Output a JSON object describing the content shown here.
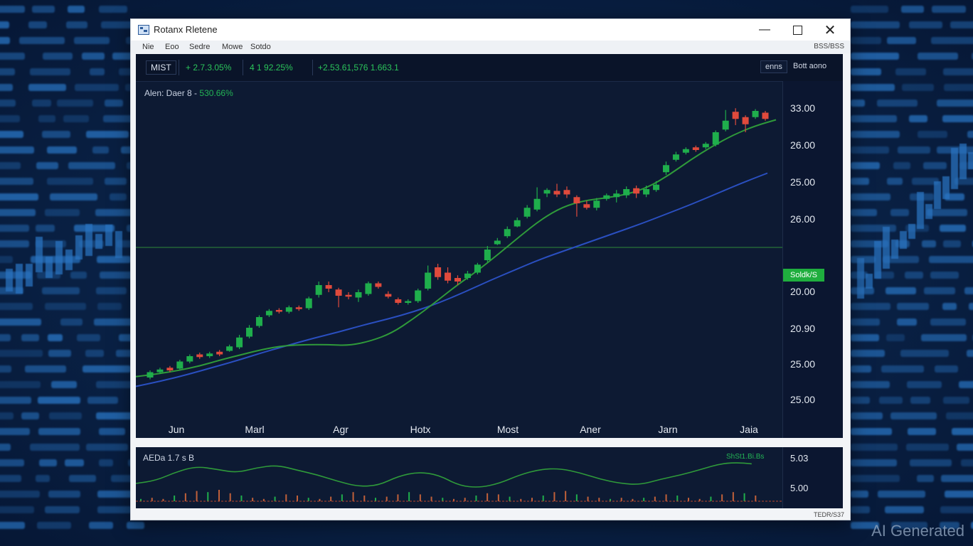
{
  "window": {
    "title": "Rotanx Rletene"
  },
  "menu": {
    "items": [
      "Nie",
      "Eoo",
      "Sedre",
      "Mowe",
      "Sotdo"
    ],
    "right_text": "BSS/BSS"
  },
  "ticker": {
    "symbol": "MIST",
    "stat1": "+ 2.7.3.05%",
    "stat2": "4 1 92.25%",
    "stat3": "+2.53.61,576 1.663.1",
    "btn1": "enns",
    "btn2": "Bott aono"
  },
  "chart_label": {
    "text": "Alen: Daer 8 -",
    "value": "530.66%"
  },
  "price_axis": [
    "33.00",
    "26.00",
    "25.00",
    "26.00",
    "20.00",
    "20.90",
    "25.00",
    "25.00"
  ],
  "price_tag": "Soldk/S",
  "dates": [
    "Jun",
    "Marl",
    "Agr",
    "Hotx",
    "Most",
    "Aner",
    "Jarn",
    "Jaia"
  ],
  "indicator": {
    "label": "AEDa 1.7 s B",
    "value": "ShSt1.Bi.Bs",
    "axis": [
      "5.03",
      "5.00"
    ]
  },
  "status_right": "TEDR/S37",
  "watermark": "AI Generated",
  "colors": {
    "up": "#1fae4c",
    "down": "#e04a3c",
    "ma_fast": "#2f9a3a",
    "ma_slow": "#2a4fc0",
    "level_line": "#2f8a3a"
  },
  "chart_data": {
    "type": "candlestick",
    "x": [
      "Jun",
      "Marl",
      "Agr",
      "Hotx",
      "Most",
      "Aner",
      "Jarn",
      "Jaia"
    ],
    "y_ticks": [
      "33.00",
      "26.00",
      "25.00",
      "26.00",
      "20.00",
      "20.90",
      "25.00",
      "25.00"
    ],
    "series": [],
    "candles": [
      {
        "o": 4.0,
        "c": 4.6,
        "h": 4.8,
        "l": 3.8
      },
      {
        "o": 4.6,
        "c": 4.9,
        "h": 5.1,
        "l": 4.4
      },
      {
        "o": 5.1,
        "c": 4.8,
        "h": 5.3,
        "l": 4.6
      },
      {
        "o": 5.0,
        "c": 5.8,
        "h": 6.0,
        "l": 4.9
      },
      {
        "o": 5.8,
        "c": 6.4,
        "h": 6.6,
        "l": 5.6
      },
      {
        "o": 6.6,
        "c": 6.3,
        "h": 6.8,
        "l": 6.1
      },
      {
        "o": 6.4,
        "c": 6.7,
        "h": 6.9,
        "l": 6.2
      },
      {
        "o": 6.9,
        "c": 6.6,
        "h": 7.1,
        "l": 6.4
      },
      {
        "o": 7.0,
        "c": 7.5,
        "h": 7.7,
        "l": 6.9
      },
      {
        "o": 7.4,
        "c": 8.5,
        "h": 8.8,
        "l": 7.2
      },
      {
        "o": 8.6,
        "c": 9.6,
        "h": 9.9,
        "l": 8.4
      },
      {
        "o": 9.8,
        "c": 10.8,
        "h": 11.0,
        "l": 9.6
      },
      {
        "o": 11.0,
        "c": 11.5,
        "h": 11.7,
        "l": 10.8
      },
      {
        "o": 11.6,
        "c": 11.4,
        "h": 11.8,
        "l": 11.2
      },
      {
        "o": 11.4,
        "c": 11.9,
        "h": 12.1,
        "l": 11.2
      },
      {
        "o": 11.9,
        "c": 11.7,
        "h": 12.1,
        "l": 11.5
      },
      {
        "o": 11.8,
        "c": 12.9,
        "h": 13.1,
        "l": 11.6
      },
      {
        "o": 13.3,
        "c": 14.4,
        "h": 14.8,
        "l": 13.0
      },
      {
        "o": 14.4,
        "c": 14.0,
        "h": 14.8,
        "l": 13.6
      },
      {
        "o": 13.9,
        "c": 13.2,
        "h": 14.1,
        "l": 11.9
      },
      {
        "o": 13.3,
        "c": 13.1,
        "h": 13.6,
        "l": 12.8
      },
      {
        "o": 13.0,
        "c": 13.6,
        "h": 13.9,
        "l": 12.5
      },
      {
        "o": 13.4,
        "c": 14.6,
        "h": 14.8,
        "l": 13.2
      },
      {
        "o": 14.6,
        "c": 14.2,
        "h": 14.8,
        "l": 14.0
      },
      {
        "o": 13.4,
        "c": 13.1,
        "h": 13.7,
        "l": 12.9
      },
      {
        "o": 12.8,
        "c": 12.4,
        "h": 13.0,
        "l": 12.2
      },
      {
        "o": 12.4,
        "c": 12.6,
        "h": 12.8,
        "l": 12.2
      },
      {
        "o": 12.6,
        "c": 13.8,
        "h": 14.0,
        "l": 12.4
      },
      {
        "o": 14.0,
        "c": 15.8,
        "h": 16.6,
        "l": 13.8
      },
      {
        "o": 16.4,
        "c": 15.3,
        "h": 16.8,
        "l": 15.0
      },
      {
        "o": 15.8,
        "c": 14.9,
        "h": 16.4,
        "l": 14.6
      },
      {
        "o": 15.2,
        "c": 14.8,
        "h": 15.5,
        "l": 14.4
      },
      {
        "o": 15.2,
        "c": 15.7,
        "h": 16.0,
        "l": 15.0
      },
      {
        "o": 15.8,
        "c": 16.7,
        "h": 16.9,
        "l": 15.6
      },
      {
        "o": 17.2,
        "c": 18.4,
        "h": 18.8,
        "l": 17.0
      },
      {
        "o": 19.0,
        "c": 19.4,
        "h": 19.7,
        "l": 18.9
      },
      {
        "o": 19.9,
        "c": 20.7,
        "h": 21.0,
        "l": 19.7
      },
      {
        "o": 21.0,
        "c": 21.7,
        "h": 22.0,
        "l": 20.9
      },
      {
        "o": 22.1,
        "c": 23.1,
        "h": 23.4,
        "l": 21.9
      },
      {
        "o": 22.9,
        "c": 24.1,
        "h": 25.4,
        "l": 22.7
      },
      {
        "o": 24.7,
        "c": 25.1,
        "h": 25.3,
        "l": 24.3
      },
      {
        "o": 25.0,
        "c": 24.6,
        "h": 25.8,
        "l": 24.3
      },
      {
        "o": 25.1,
        "c": 24.6,
        "h": 25.5,
        "l": 24.2
      },
      {
        "o": 24.3,
        "c": 23.6,
        "h": 24.5,
        "l": 22.1
      },
      {
        "o": 23.5,
        "c": 23.1,
        "h": 23.9,
        "l": 22.9
      },
      {
        "o": 23.1,
        "c": 23.9,
        "h": 24.2,
        "l": 22.8
      },
      {
        "o": 24.1,
        "c": 24.5,
        "h": 24.7,
        "l": 23.9
      },
      {
        "o": 24.3,
        "c": 24.7,
        "h": 25.1,
        "l": 23.7
      },
      {
        "o": 24.5,
        "c": 25.2,
        "h": 25.5,
        "l": 24.2
      },
      {
        "o": 25.3,
        "c": 24.7,
        "h": 25.6,
        "l": 24.2
      },
      {
        "o": 24.6,
        "c": 25.2,
        "h": 25.6,
        "l": 24.3
      },
      {
        "o": 25.1,
        "c": 25.7,
        "h": 26.1,
        "l": 24.9
      },
      {
        "o": 27.1,
        "c": 27.9,
        "h": 28.3,
        "l": 26.8
      },
      {
        "o": 28.5,
        "c": 29.1,
        "h": 29.4,
        "l": 28.3
      },
      {
        "o": 29.3,
        "c": 29.7,
        "h": 29.9,
        "l": 29.1
      },
      {
        "o": 29.9,
        "c": 29.6,
        "h": 30.1,
        "l": 29.4
      },
      {
        "o": 29.9,
        "c": 30.3,
        "h": 30.5,
        "l": 29.7
      },
      {
        "o": 30.2,
        "c": 31.6,
        "h": 31.8,
        "l": 30.0
      },
      {
        "o": 31.9,
        "c": 32.9,
        "h": 34.1,
        "l": 31.7
      },
      {
        "o": 33.9,
        "c": 33.1,
        "h": 34.3,
        "l": 32.4
      },
      {
        "o": 33.3,
        "c": 32.5,
        "h": 33.5,
        "l": 31.6
      },
      {
        "o": 33.3,
        "c": 34.0,
        "h": 34.2,
        "l": 33.1
      },
      {
        "o": 33.8,
        "c": 33.1,
        "h": 34.0,
        "l": 32.9
      }
    ],
    "ma_fast": [
      4.1,
      4.4,
      4.8,
      5.3,
      6.0,
      6.6,
      7.2,
      7.6,
      7.7,
      7.7,
      7.6,
      8.1,
      9.0,
      10.6,
      12.4,
      14.3,
      16.0,
      17.9,
      19.9,
      21.8,
      23.2,
      23.9,
      24.2,
      24.6,
      25.4,
      26.8,
      28.5,
      30.0,
      31.3,
      32.3,
      33.0
    ],
    "ma_slow": [
      3.0,
      3.6,
      4.3,
      5.1,
      5.9,
      6.8,
      7.6,
      8.4,
      9.1,
      9.9,
      10.6,
      11.4,
      12.4,
      13.6,
      14.9,
      16.1,
      17.3,
      18.3,
      19.3,
      20.3,
      21.3,
      22.4,
      23.5,
      24.7,
      25.9,
      27.0
    ]
  },
  "indicator_data": {
    "line": [
      0.35,
      0.42,
      0.62,
      0.75,
      0.68,
      0.6,
      0.72,
      0.78,
      0.66,
      0.55,
      0.4,
      0.28,
      0.3,
      0.52,
      0.62,
      0.55,
      0.3,
      0.25,
      0.35,
      0.55,
      0.68,
      0.7,
      0.6,
      0.45,
      0.35,
      0.32,
      0.45,
      0.55,
      0.68,
      0.82,
      0.84,
      0.78
    ],
    "bars": [
      0.2,
      0.3,
      0.2,
      0.5,
      0.7,
      0.9,
      0.8,
      1.0,
      0.7,
      0.5,
      0.3,
      0.2,
      0.4,
      0.6,
      0.5,
      0.3,
      0.2,
      0.4,
      0.6,
      0.8,
      0.5,
      0.3,
      0.4,
      0.6,
      0.8,
      0.6,
      0.4,
      0.3,
      0.2,
      0.3,
      0.5,
      0.7,
      0.6,
      0.4,
      0.2,
      0.3,
      0.5,
      0.8,
      0.9,
      0.6,
      0.4,
      0.3,
      0.2,
      0.3,
      0.2,
      0.3,
      0.4,
      0.6,
      0.5,
      0.3,
      0.2,
      0.4,
      0.6,
      0.8,
      0.7,
      0.5
    ]
  }
}
